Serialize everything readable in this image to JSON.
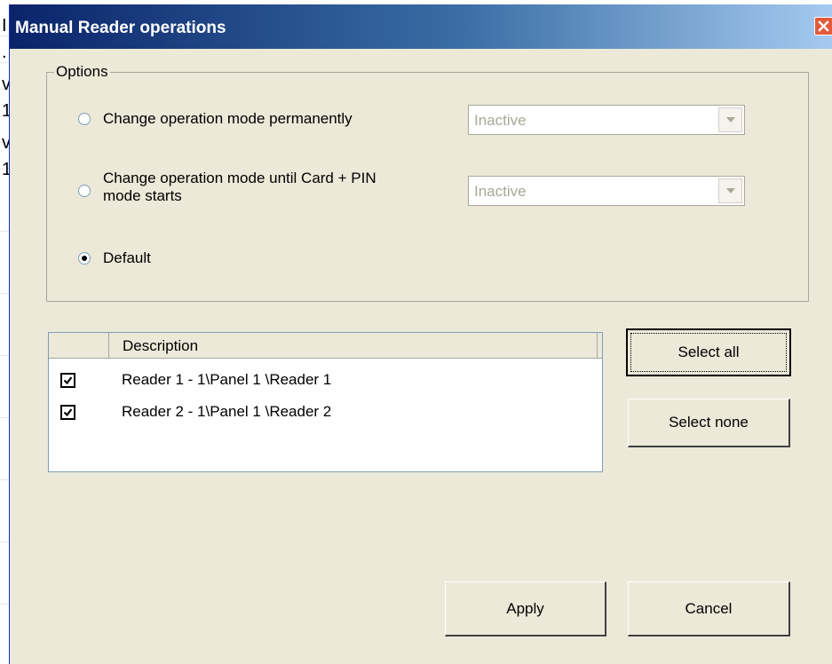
{
  "window": {
    "title": "Manual Reader operations"
  },
  "background_fragment": {
    "chars": [
      "I",
      ".",
      "v",
      "1",
      "v",
      "1"
    ]
  },
  "options": {
    "group_label": "Options",
    "items": [
      {
        "label": "Change operation mode  permanently",
        "checked": false,
        "combo_value": "Inactive"
      },
      {
        "label_line1": "Change operation mode until Card + PIN",
        "label_line2": "mode starts",
        "checked": false,
        "combo_value": "Inactive"
      },
      {
        "label": "Default",
        "checked": true
      }
    ]
  },
  "list": {
    "columns": [
      "",
      "Description"
    ],
    "rows": [
      {
        "checked": true,
        "description": "Reader 1 - 1\\Panel 1 \\Reader 1"
      },
      {
        "checked": true,
        "description": "Reader 2 - 1\\Panel 1 \\Reader 2"
      }
    ]
  },
  "buttons": {
    "select_all": "Select all",
    "select_none": "Select none",
    "apply": "Apply",
    "cancel": "Cancel"
  },
  "icons": {
    "close": "close-icon",
    "dropdown": "chevron-down-icon",
    "check": "check-icon"
  },
  "colors": {
    "titlebar_start": "#0a246a",
    "titlebar_end": "#a6caf0",
    "dialog_bg": "#ece9d8",
    "disabled_text": "#a8a89a",
    "close_button": "#e35a3c"
  }
}
